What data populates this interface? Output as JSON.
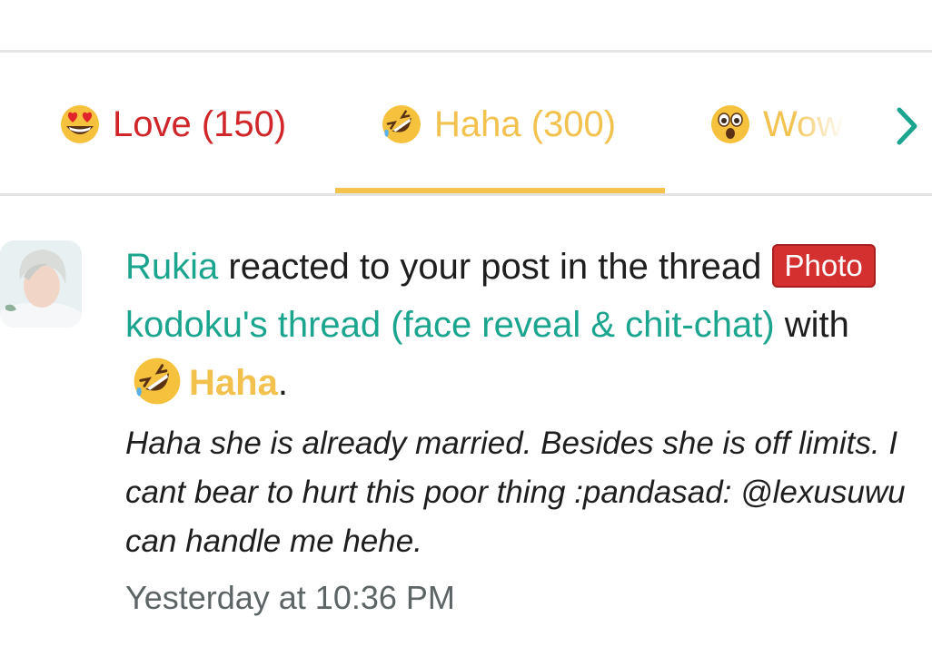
{
  "tabs": [
    {
      "label": "Love (150)",
      "emoji": "heart-eyes-emoji",
      "color": "#d0262a"
    },
    {
      "label": "Haha (300)",
      "emoji": "laughing-rolling-emoji",
      "color": "#f2c14e",
      "active": true
    },
    {
      "label": "Wow",
      "emoji": "astonished-emoji",
      "color": "#f2c14e"
    }
  ],
  "accent_color": "#1ba58e",
  "alert": {
    "user": "Rukia",
    "text_1": " reacted to your post in the thread ",
    "prefix_badge": "Photo",
    "thread_title": "kodoku's thread (face reveal & chit-chat)",
    "text_2": " with ",
    "reaction": "Haha",
    "end": ".",
    "snippet": "Haha she is already married. Besides she is off limits. I cant bear to hurt this poor thing :pandasad: @lexusuwu can handle me hehe.",
    "time": "Yesterday at 10:36 PM"
  }
}
